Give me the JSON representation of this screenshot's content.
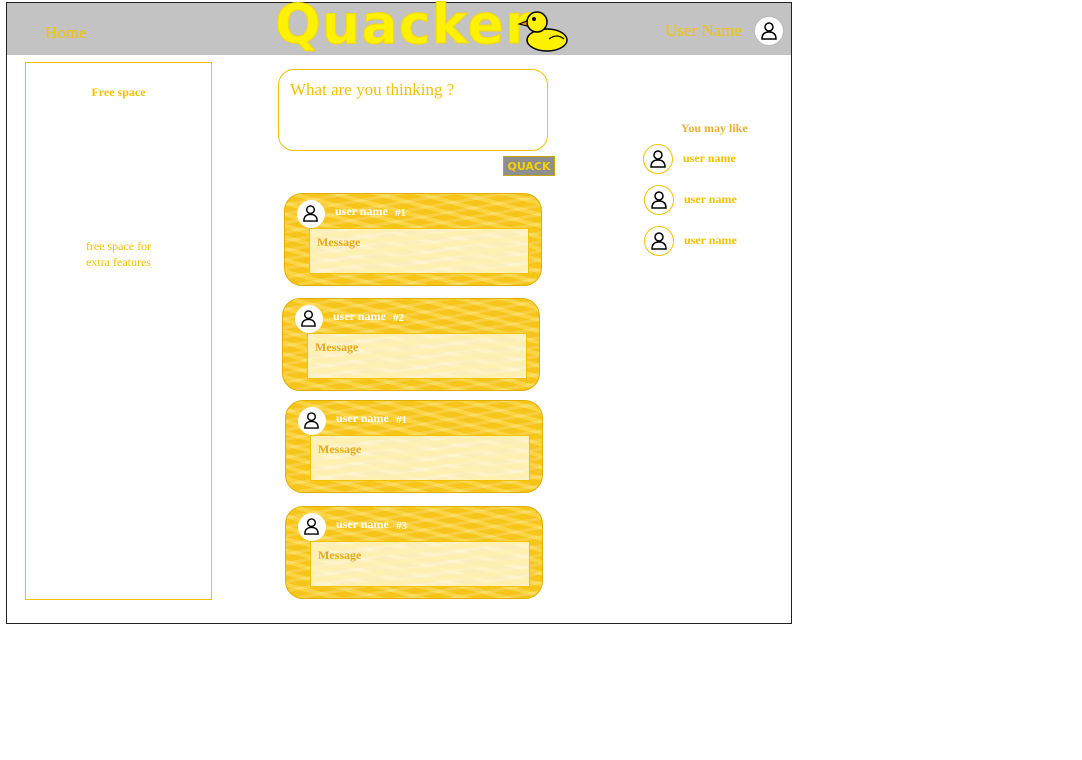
{
  "header": {
    "home_label": "Home",
    "logo_text": "Quacker",
    "user_name": "User Name"
  },
  "sidebar": {
    "title": "Free space",
    "description_line1": "free space for",
    "description_line2": "extra features"
  },
  "composer": {
    "placeholder": "What are you thinking ?",
    "submit_label": "QUACK"
  },
  "feed": {
    "posts": [
      {
        "user": "user name",
        "number": "#1",
        "message": "Message"
      },
      {
        "user": "user name",
        "number": "#2",
        "message": "Message"
      },
      {
        "user": "user name",
        "number": "#1",
        "message": "Message"
      },
      {
        "user": "user name",
        "number": "#3",
        "message": "Message"
      }
    ]
  },
  "recommendations": {
    "title": "You may like",
    "users": [
      {
        "name": "user name"
      },
      {
        "name": "user name"
      },
      {
        "name": "user name"
      }
    ]
  },
  "colors": {
    "accent": "#f2c200",
    "header_bg": "#c3c3c3",
    "post_bg": "#f7c51a"
  }
}
